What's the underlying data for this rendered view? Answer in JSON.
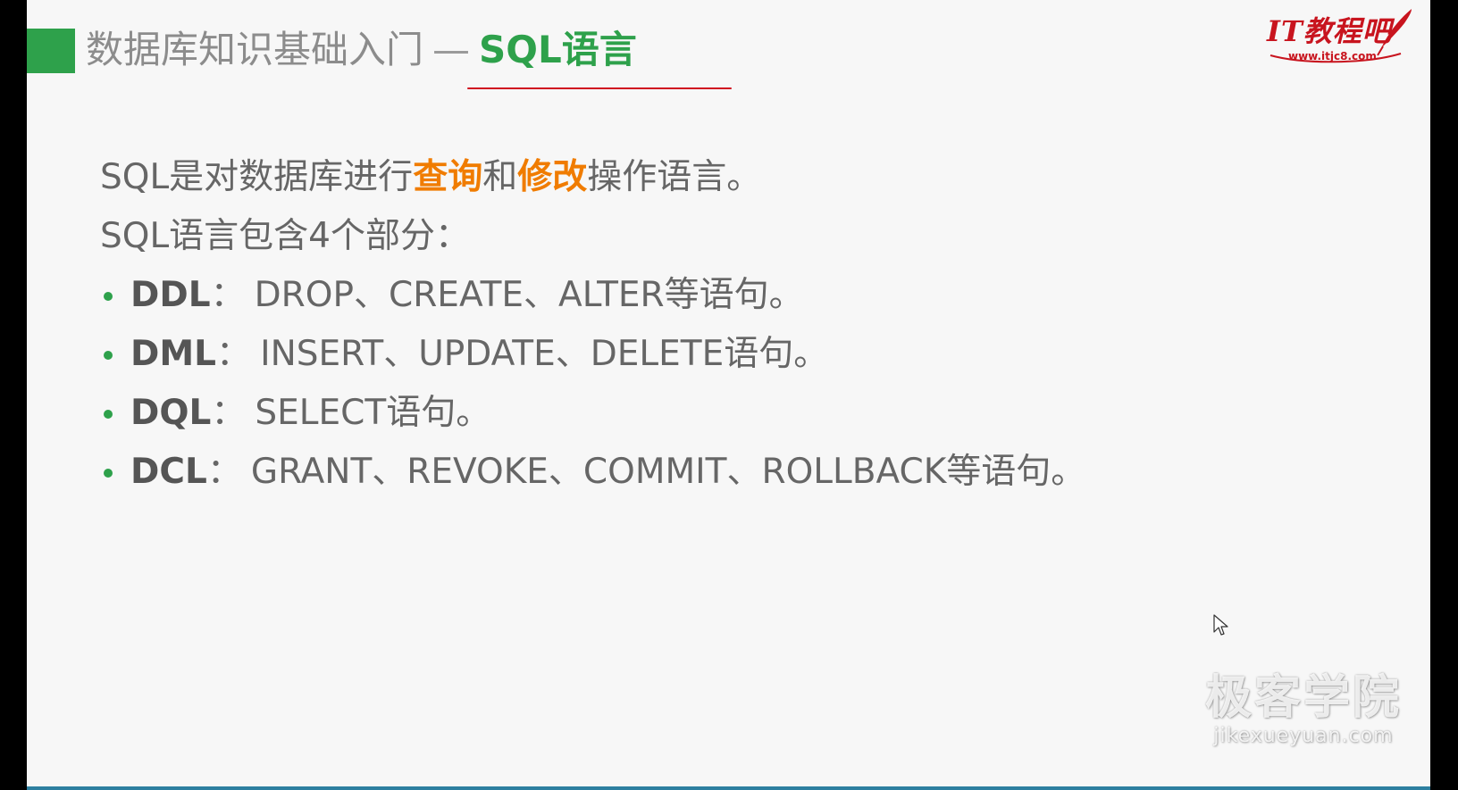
{
  "header": {
    "title_prefix": "数据库知识基础入门",
    "title_dash": "—",
    "title_highlight": "SQL语言"
  },
  "logo": {
    "brand": "IT教程吧",
    "url": "www.itjc8.com"
  },
  "intro": {
    "part1": "SQL是对数据库进行",
    "kw1": "查询",
    "part2": "和",
    "kw2": "修改",
    "part3": "操作语言。"
  },
  "subtitle": "SQL语言包含4个部分：",
  "bullets": [
    {
      "term": "DDL",
      "colon": "：",
      "text": "DROP、CREATE、ALTER等语句。"
    },
    {
      "term": "DML",
      "colon": "：",
      "text": "INSERT、UPDATE、DELETE语句。"
    },
    {
      "term": "DQL",
      "colon": "：",
      "text": "SELECT语句。"
    },
    {
      "term": "DCL",
      "colon": "：",
      "text": "GRANT、REVOKE、COMMIT、ROLLBACK等语句。"
    }
  ],
  "watermark": {
    "main": "极客学院",
    "sub": "jikexueyuan.com"
  },
  "colors": {
    "accent_green": "#2ea14b",
    "accent_orange": "#f07c00",
    "logo_red": "#c8141e",
    "underline_red": "#d01020"
  },
  "icons": {
    "cursor": "mouse-pointer-icon",
    "pen": "quill-pen-icon"
  }
}
